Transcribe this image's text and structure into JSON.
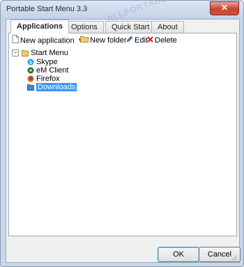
{
  "window": {
    "title": "Portable Start Menu 3.3",
    "close_label": "✕"
  },
  "tabs": [
    {
      "label": "Applications"
    },
    {
      "label": "Options"
    },
    {
      "label": "Quick Start"
    },
    {
      "label": "About"
    }
  ],
  "toolbar": {
    "new_application": "New application",
    "new_folder": "New folder",
    "edit": "Edit",
    "delete": "Delete",
    "dropdown_arrow": "▾"
  },
  "tree": {
    "root": "Start Menu",
    "expander": "−",
    "items": [
      {
        "label": "Skype",
        "icon": "skype-icon",
        "color": "#1ba1e2"
      },
      {
        "label": "eM Client",
        "icon": "em-client-icon",
        "color": "#2c6e2f"
      },
      {
        "label": "Firefox",
        "icon": "firefox-icon",
        "color": "#e66000"
      },
      {
        "label": "Downloads",
        "icon": "folder-icon",
        "color": "#4a86c8",
        "selected": true
      }
    ]
  },
  "buttons": {
    "ok": "OK",
    "cancel": "Cancel"
  },
  "watermark": "ALLPORTABLE.RU",
  "colors": {
    "selection": "#3399ff",
    "close_button": "#c7422f"
  }
}
